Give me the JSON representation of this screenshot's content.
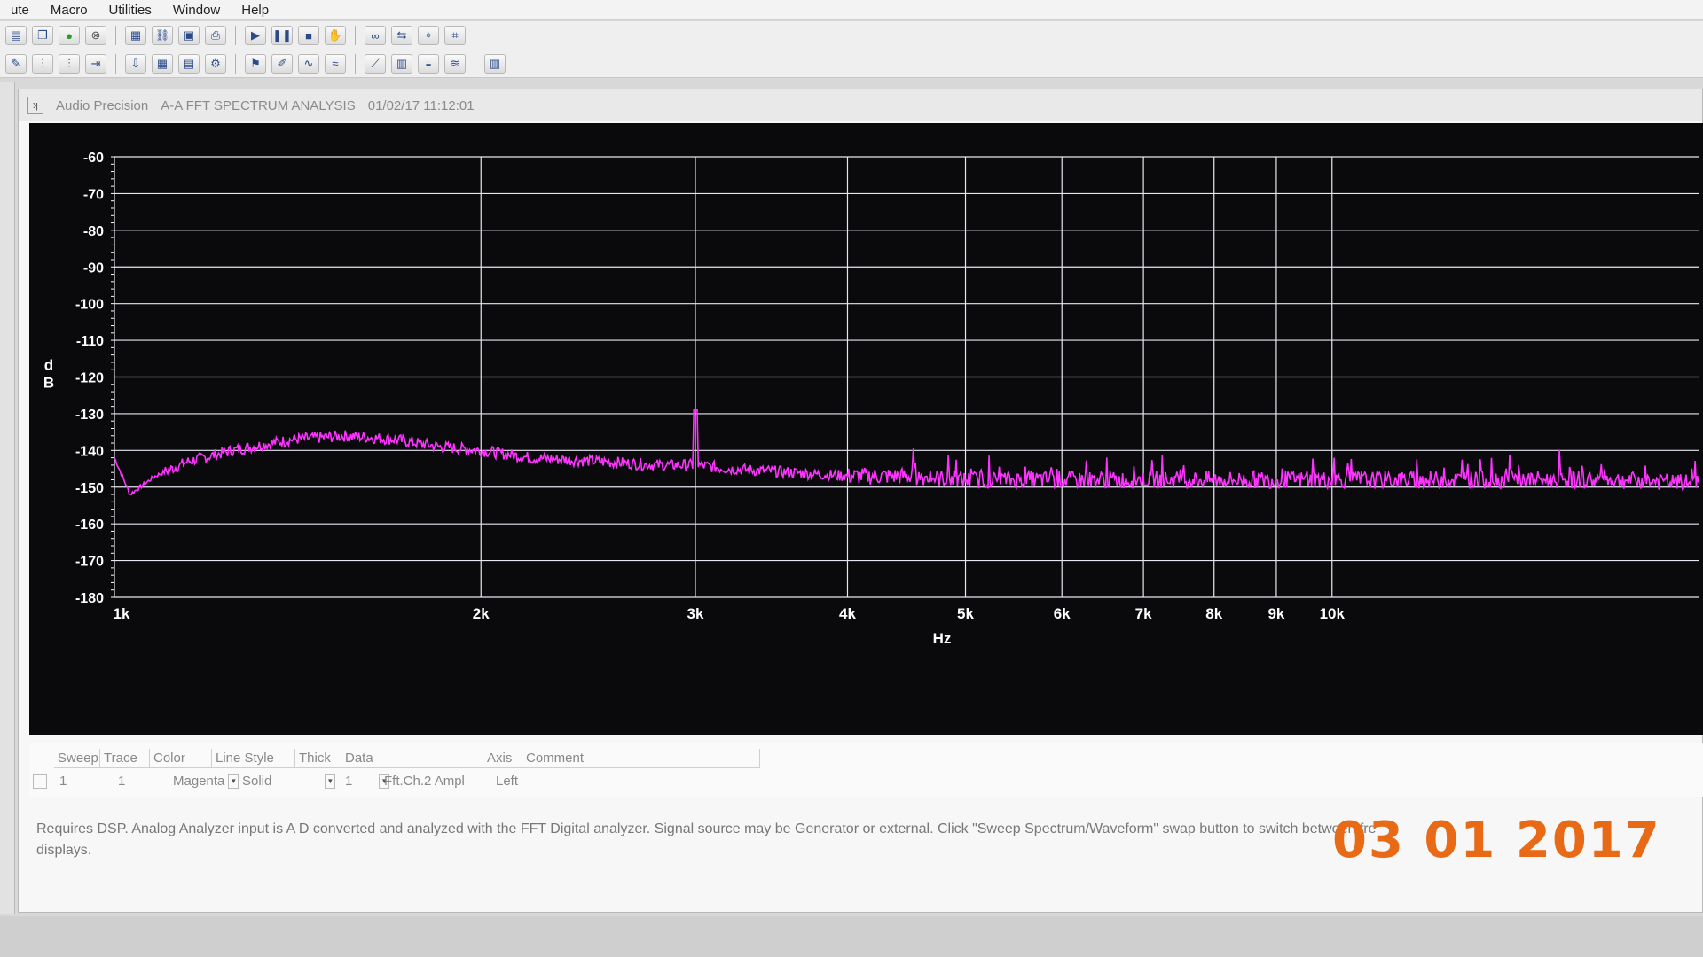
{
  "menu": [
    "ute",
    "Macro",
    "Utilities",
    "Window",
    "Help"
  ],
  "toolbar_row1": [
    "open-icon",
    "copy-icon",
    "green-run-icon",
    "stop-circle-icon",
    "grid-icon",
    "link-icon",
    "panel-icon",
    "print-icon",
    "play-icon",
    "pause-icon",
    "stop-icon",
    "hand-icon",
    "binoculars-icon",
    "sweep-icon",
    "cursor-icon",
    "marker-icon"
  ],
  "toolbar_row2": [
    "tool-icon",
    "mixer-icon",
    "mixer2-icon",
    "import-icon",
    "export-icon",
    "table-icon",
    "sheet-icon",
    "settings-icon",
    "flag-icon",
    "edit-icon",
    "graph-a-icon",
    "graph-b-icon",
    "graph-c-icon",
    "graph-d-icon",
    "graph-e-icon",
    "graph-f-icon",
    "graph-g-icon"
  ],
  "window": {
    "brand": "Audio Precision",
    "title": "A-A FFT SPECTRUM ANALYSIS",
    "timestamp": "01/02/17 11:12:01"
  },
  "legend": {
    "headers": [
      "Sweep",
      "Trace",
      "Color",
      "Line Style",
      "Thick",
      "Data",
      "Axis",
      "Comment"
    ],
    "row": {
      "sweep": "1",
      "trace": "1",
      "color": "Magenta",
      "line_style": "Solid",
      "thick": "1",
      "data": "Fft.Ch.2 Ampl",
      "axis": "Left"
    }
  },
  "description_line1": "Requires DSP.  Analog Analyzer input is A D converted and analyzed with the FFT Digital analyzer.  Signal source may be Generator or external.  Click \"Sweep Spectrum/Waveform\" swap button to switch between fre",
  "description_line2": "displays.",
  "date_stamp": "03 01 2017",
  "colors": {
    "trace": "#ff33ff",
    "grid": "#e6e6f0",
    "plot_bg": "#0a0a0d",
    "stamp": "#e86a16"
  },
  "chart_data": {
    "type": "line",
    "title": "",
    "xlabel": "Hz",
    "ylabel": "dB",
    "x_scale": "log",
    "xlim": [
      1000,
      20000
    ],
    "ylim": [
      -180,
      -60
    ],
    "x_ticks": [
      1000,
      2000,
      3000,
      4000,
      5000,
      6000,
      7000,
      8000,
      9000,
      10000
    ],
    "x_tick_labels": [
      "1k",
      "2k",
      "3k",
      "4k",
      "5k",
      "6k",
      "7k",
      "8k",
      "9k",
      "10k"
    ],
    "y_ticks": [
      -60,
      -70,
      -80,
      -90,
      -100,
      -110,
      -120,
      -130,
      -140,
      -150,
      -160,
      -170,
      -180
    ],
    "y_tick_labels": [
      "-60",
      "-70",
      "-80",
      "-90",
      "-100",
      "-110",
      "-120",
      "-130",
      "-140",
      "-150",
      "-160",
      "-170",
      "-180"
    ],
    "grid": true,
    "series": [
      {
        "name": "Fft.Ch.2 Ampl",
        "x": [
          1000,
          1030,
          1080,
          1150,
          1250,
          1400,
          1550,
          1700,
          1850,
          2000,
          2200,
          2500,
          2800,
          2990,
          3000,
          3010,
          3200,
          3600,
          4000,
          4500,
          5000,
          6000,
          7000,
          8000,
          9000,
          10000,
          12000,
          14000,
          17000,
          20000
        ],
        "y": [
          -142,
          -152,
          -147,
          -143,
          -140,
          -137,
          -136,
          -137,
          -139,
          -140,
          -142,
          -143,
          -144,
          -144,
          -129,
          -144,
          -145,
          -146,
          -147,
          -147,
          -148,
          -148,
          -148,
          -148,
          -148,
          -148,
          -148,
          -148,
          -148,
          -149
        ]
      }
    ]
  }
}
